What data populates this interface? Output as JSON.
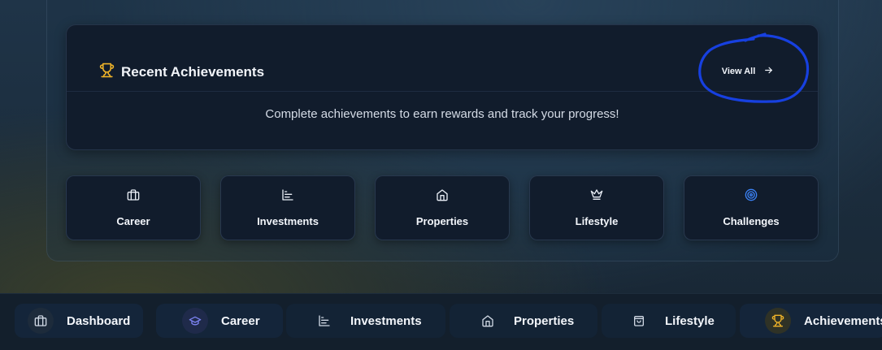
{
  "achievements": {
    "title": "Recent Achievements",
    "view_all_label": "View All",
    "empty_message": "Complete achievements to earn rewards and track your progress!"
  },
  "categories": [
    {
      "label": "Career",
      "icon": "briefcase-icon"
    },
    {
      "label": "Investments",
      "icon": "chart-icon"
    },
    {
      "label": "Properties",
      "icon": "home-icon"
    },
    {
      "label": "Lifestyle",
      "icon": "crown-icon"
    },
    {
      "label": "Challenges",
      "icon": "target-icon"
    }
  ],
  "bottom_nav": [
    {
      "label": "Dashboard",
      "icon": "briefcase-icon"
    },
    {
      "label": "Career",
      "icon": "graduation-cap-icon"
    },
    {
      "label": "Investments",
      "icon": "chart-icon"
    },
    {
      "label": "Properties",
      "icon": "home-icon"
    },
    {
      "label": "Lifestyle",
      "icon": "shopping-bag-icon"
    },
    {
      "label": "Achievements",
      "icon": "trophy-icon"
    }
  ],
  "colors": {
    "accent_gold": "#f0b429",
    "accent_blue": "#3b82f6",
    "annotation_blue": "#1740e0"
  }
}
